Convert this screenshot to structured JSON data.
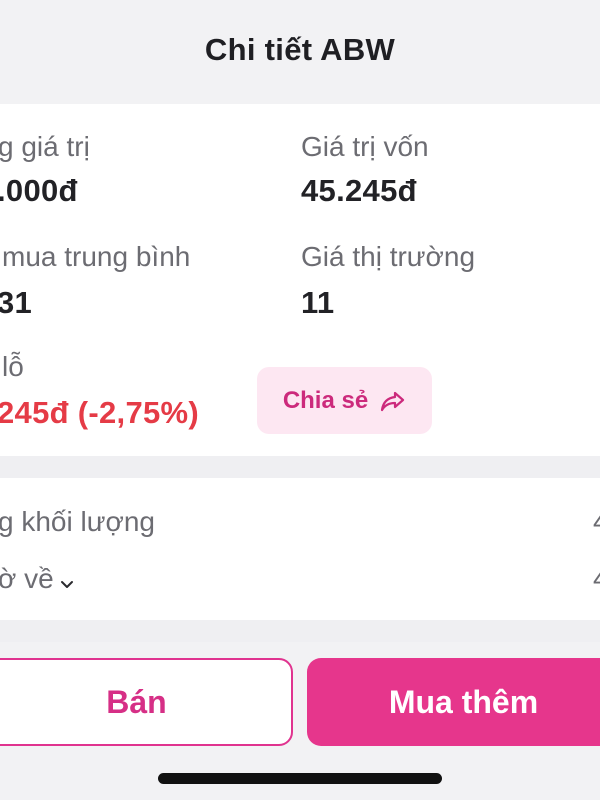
{
  "header": {
    "title": "Chi tiết ABW"
  },
  "info": {
    "total_value": {
      "label": "g giá trị",
      "value": ".000đ"
    },
    "cost_value": {
      "label": "Giá trị vốn",
      "value": "45.245đ"
    },
    "avg_price": {
      "label": "mua trung bình",
      "value": "31"
    },
    "market_price": {
      "label": "Giá thị trường",
      "value": "11"
    },
    "profit_loss": {
      "label": "lỗ",
      "value": "245đ (-2,75%)"
    },
    "share_button": {
      "label": "Chia sẻ",
      "icon": "share-arrow-icon"
    }
  },
  "volume": {
    "total_volume": {
      "label": "g khối lượng",
      "value": "4"
    },
    "arriving": {
      "label": "ờ về",
      "value": "4",
      "icon": "chevron-down-icon"
    }
  },
  "actions": {
    "sell_label": "Bán",
    "buy_more_label": "Mua thêm"
  },
  "colors": {
    "accent": "#e6368c",
    "negative": "#e53b46",
    "share_bg": "#fde7f2"
  }
}
